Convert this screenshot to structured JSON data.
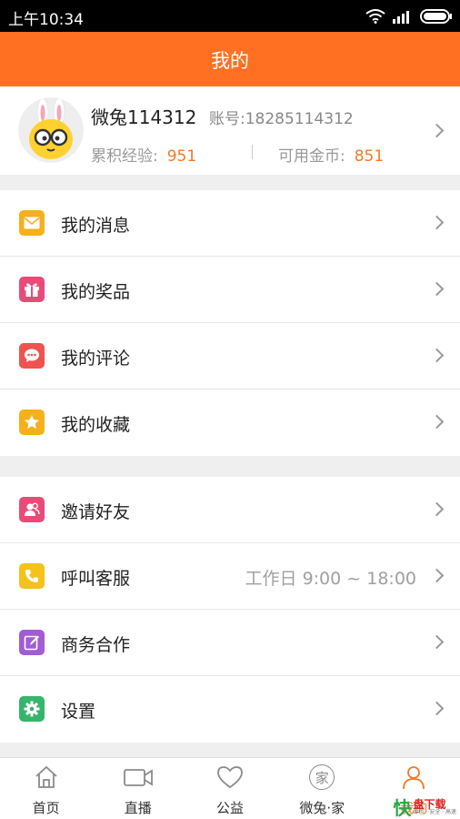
{
  "status_bar": {
    "time": "上午10:34"
  },
  "app_bar": {
    "title": "我的"
  },
  "profile": {
    "name": "微兔114312",
    "account_label": "账号:",
    "account": "18285114312",
    "exp_label": "累积经验:",
    "exp_value": "951",
    "coin_label": "可用金币:",
    "coin_value": "851"
  },
  "menu_group_1": [
    {
      "label": "我的消息",
      "icon": "envelope-icon",
      "color": "#f5b01c"
    },
    {
      "label": "我的奖品",
      "icon": "gift-icon",
      "color": "#e94b78"
    },
    {
      "label": "我的评论",
      "icon": "comment-icon",
      "color": "#ef5350"
    },
    {
      "label": "我的收藏",
      "icon": "star-icon",
      "color": "#f5b01c"
    }
  ],
  "menu_group_2": [
    {
      "label": "邀请好友",
      "icon": "invite-friends-icon",
      "color": "#e94b78"
    },
    {
      "label": "呼叫客服",
      "icon": "phone-icon",
      "color": "#f5c21c",
      "note": "工作日  9:00 ~ 18:00"
    },
    {
      "label": "商务合作",
      "icon": "edit-icon",
      "color": "#a25cd6"
    },
    {
      "label": "设置",
      "icon": "gear-icon",
      "color": "#35b56b"
    }
  ],
  "tab_bar": [
    {
      "label": "首页",
      "icon": "home-icon"
    },
    {
      "label": "直播",
      "icon": "video-camera-icon"
    },
    {
      "label": "公益",
      "icon": "heart-icon"
    },
    {
      "label": "微兔·家",
      "icon": "jia-icon",
      "glyph": "家"
    },
    {
      "label": "我的",
      "icon": "user-icon",
      "active": true
    }
  ],
  "watermark": {
    "big": "快",
    "title": "盘下载",
    "sub": "绿色 · 安全 · 高速"
  },
  "colors": {
    "accent": "#ff7022",
    "number": "#f07a2a"
  }
}
